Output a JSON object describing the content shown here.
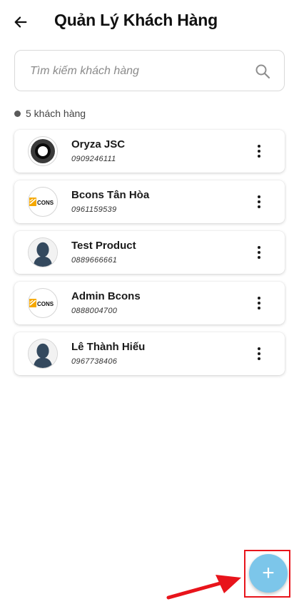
{
  "header": {
    "title": "Quản Lý Khách Hàng",
    "back_icon": "arrow-left-icon"
  },
  "search": {
    "placeholder": "Tìm kiếm khách hàng",
    "value": "",
    "icon": "search-icon"
  },
  "summary": {
    "count_label": "5 khách hàng"
  },
  "customers": [
    {
      "name": "Oryza JSC",
      "phone": "0909246111",
      "avatar": "ring-logo"
    },
    {
      "name": "Bcons Tân Hòa",
      "phone": "0961159539",
      "avatar": "bcons-logo"
    },
    {
      "name": "Test Product",
      "phone": "0889666661",
      "avatar": "person-silhouette"
    },
    {
      "name": "Admin Bcons",
      "phone": "0888004700",
      "avatar": "bcons-logo"
    },
    {
      "name": "Lê Thành Hiếu",
      "phone": "0967738406",
      "avatar": "person-silhouette"
    }
  ],
  "fab": {
    "label": "+",
    "icon": "plus-icon"
  },
  "colors": {
    "fab": "#7cc6ea",
    "highlight": "#e8141b",
    "bcons_yellow": "#f5a800",
    "silhouette": "#34495e"
  },
  "logos": {
    "bcons_text": "CONS"
  }
}
